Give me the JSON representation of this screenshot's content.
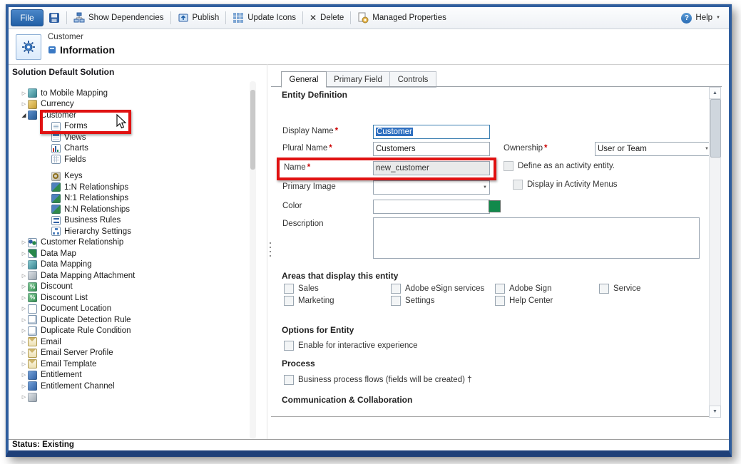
{
  "toolbar": {
    "file_label": "File",
    "buttons": [
      "Show Dependencies",
      "Publish",
      "Update Icons",
      "Delete",
      "Managed Properties"
    ],
    "help_label": "Help"
  },
  "header": {
    "entity_name": "Customer",
    "page_title": "Information"
  },
  "sidebar": {
    "title": "Solution Default Solution",
    "items": [
      {
        "label": "to Mobile Mapping"
      },
      {
        "label": "Currency"
      },
      {
        "label": "Customer"
      },
      {
        "label": "Forms"
      },
      {
        "label": "Views"
      },
      {
        "label": "Charts"
      },
      {
        "label": "Fields"
      },
      {
        "label": "Keys"
      },
      {
        "label": "1:N Relationships"
      },
      {
        "label": "N:1 Relationships"
      },
      {
        "label": "N:N Relationships"
      },
      {
        "label": "Business Rules"
      },
      {
        "label": "Hierarchy Settings"
      },
      {
        "label": "Customer Relationship"
      },
      {
        "label": "Data Map"
      },
      {
        "label": "Data Mapping"
      },
      {
        "label": "Data Mapping Attachment"
      },
      {
        "label": "Discount"
      },
      {
        "label": "Discount List"
      },
      {
        "label": "Document Location"
      },
      {
        "label": "Duplicate Detection Rule"
      },
      {
        "label": "Duplicate Rule Condition"
      },
      {
        "label": "Email"
      },
      {
        "label": "Email Server Profile"
      },
      {
        "label": "Email Template"
      },
      {
        "label": "Entitlement"
      },
      {
        "label": "Entitlement Channel"
      },
      {
        "label": ""
      }
    ]
  },
  "main": {
    "tabs": [
      {
        "label": "General"
      },
      {
        "label": "Primary Field"
      },
      {
        "label": "Controls"
      }
    ],
    "sections": {
      "entity_definition": "Entity Definition",
      "areas": "Areas that display this entity",
      "options": "Options for Entity",
      "process": "Process",
      "communication": "Communication & Collaboration"
    },
    "fields": {
      "display_name": {
        "label": "Display Name",
        "value": "Customer"
      },
      "plural_name": {
        "label": "Plural Name",
        "value": "Customers"
      },
      "ownership": {
        "label": "Ownership",
        "value": "User or Team"
      },
      "name": {
        "label": "Name",
        "value": "new_customer"
      },
      "primary_image": {
        "label": "Primary Image",
        "value": ""
      },
      "color": {
        "label": "Color",
        "value": "",
        "swatch_color": "#12894b"
      },
      "description": {
        "label": "Description",
        "value": ""
      }
    },
    "checkboxes": {
      "activity_entity": "Define as an activity entity.",
      "activity_menus": "Display in Activity Menus",
      "interactive": "Enable for interactive experience",
      "process_flows": "Business process flows (fields will be created) †"
    },
    "areas_grid": [
      [
        "Sales",
        "Marketing"
      ],
      [
        "Adobe eSign services",
        "Settings"
      ],
      [
        "Adobe Sign",
        "Help Center"
      ],
      [
        "Service"
      ]
    ]
  },
  "statusbar": {
    "text": "Status: Existing"
  },
  "annotations": {
    "box_color": "#e01212"
  }
}
